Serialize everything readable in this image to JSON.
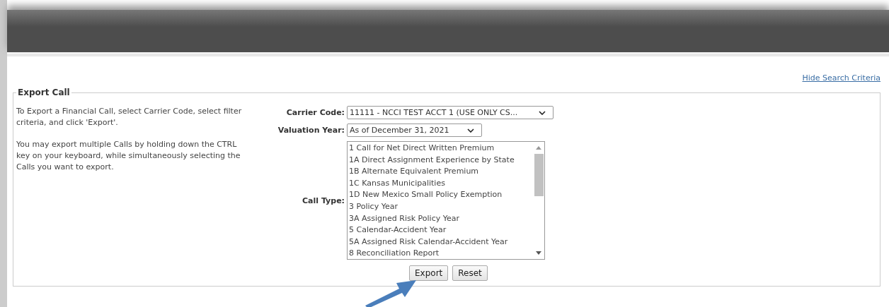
{
  "hide_link": "Hide Search Criteria",
  "panel": {
    "legend": "Export Call",
    "instructions": [
      "To Export a Financial Call, select Carrier Code, select filter criteria, and click 'Export'.",
      "You may export multiple Calls by holding down the CTRL key on your keyboard, while simultaneously selecting the Calls you want to export."
    ],
    "carrier_code": {
      "label": "Carrier Code:",
      "value": "11111 - NCCI TEST ACCT 1 (USE ONLY CS..."
    },
    "valuation_year": {
      "label": "Valuation Year:",
      "value": "As of December 31, 2021"
    },
    "call_type": {
      "label": "Call Type:",
      "options": [
        {
          "label": "1 Call for Net Direct Written Premium",
          "selected": false
        },
        {
          "label": "1A Direct Assignment Experience by State",
          "selected": false
        },
        {
          "label": "1B Alternate Equivalent Premium",
          "selected": false
        },
        {
          "label": "1C Kansas Municipalities",
          "selected": false
        },
        {
          "label": "1D New Mexico Small Policy Exemption",
          "selected": false
        },
        {
          "label": "3 Policy Year",
          "selected": false
        },
        {
          "label": "3A Assigned Risk Policy Year",
          "selected": false
        },
        {
          "label": "5 Calendar-Accident Year",
          "selected": false
        },
        {
          "label": "5A Assigned Risk Calendar-Accident Year",
          "selected": false
        },
        {
          "label": "8 Reconciliation Report",
          "selected": false
        }
      ]
    },
    "buttons": [
      "Export",
      "Reset"
    ]
  }
}
